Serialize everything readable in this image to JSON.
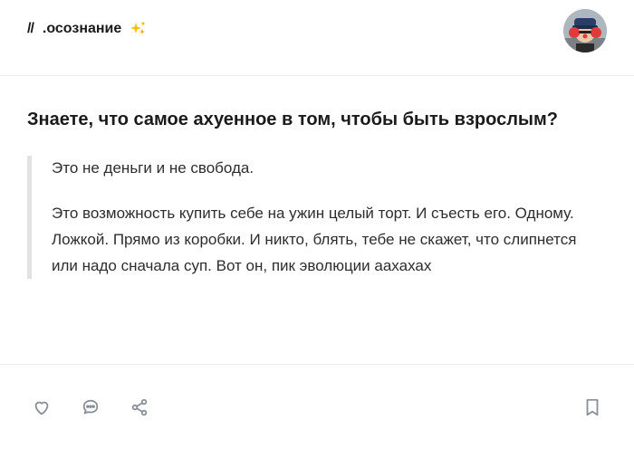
{
  "header": {
    "channel_prefix": "//",
    "channel_name": ".осознание",
    "emoji_icon": "sparkles-emoji"
  },
  "post": {
    "title": "Знаете, что самое ахуенное в том, чтобы быть взрослым?",
    "quote_paragraphs": [
      "Это не деньги и не свобода.",
      "Это возможность купить себе на ужин целый торт. И съесть его. Одному. Ложкой. Прямо из коробки. И никто, блять, тебе не скажет, что слипнется или надо сначала суп. Вот он, пик эволюции аахахах"
    ]
  },
  "actions": {
    "icons": [
      "heart-icon",
      "comment-icon",
      "share-icon",
      "bookmark-icon"
    ]
  },
  "colors": {
    "quote_border": "#e2e2e2",
    "icon": "#8a8f98",
    "divider": "#ececec"
  }
}
